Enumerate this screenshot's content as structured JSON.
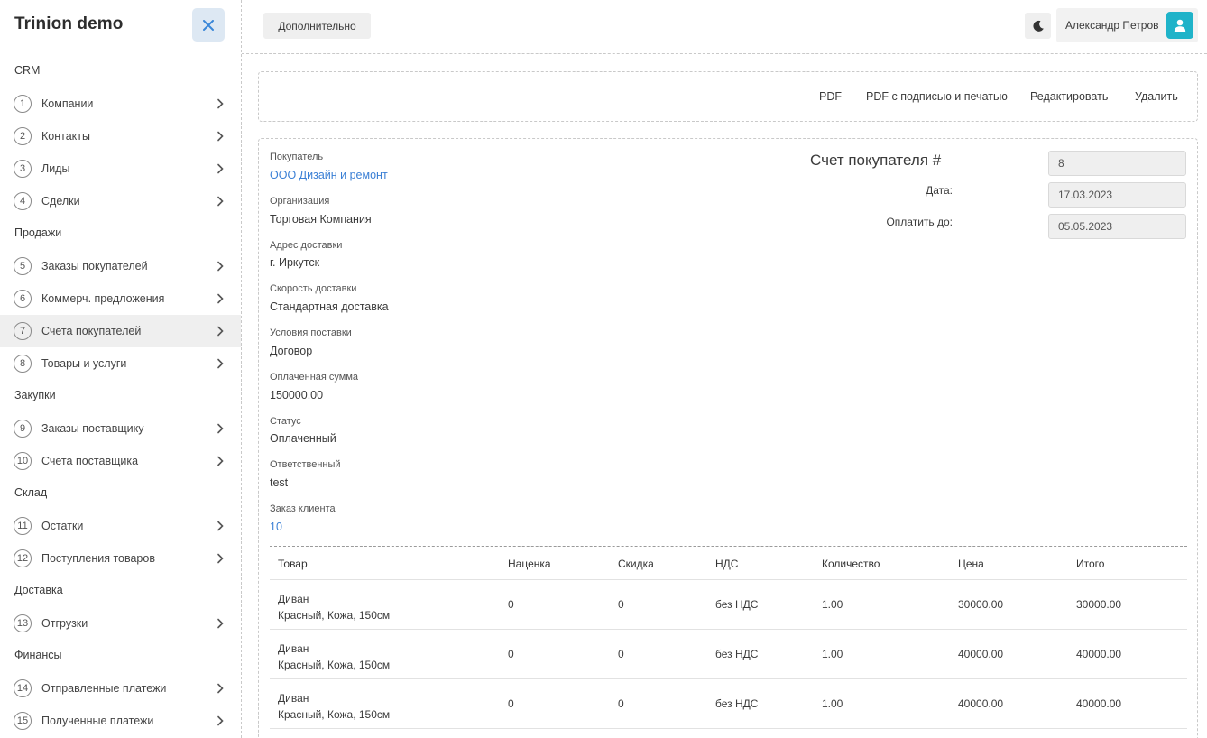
{
  "app": {
    "brand": "Trinion demo"
  },
  "sidebar": {
    "sections": [
      {
        "title": "CRM",
        "items": [
          {
            "num": "1",
            "label": "Компании"
          },
          {
            "num": "2",
            "label": "Контакты"
          },
          {
            "num": "3",
            "label": "Лиды"
          },
          {
            "num": "4",
            "label": "Сделки"
          }
        ]
      },
      {
        "title": "Продажи",
        "items": [
          {
            "num": "5",
            "label": "Заказы покупателей"
          },
          {
            "num": "6",
            "label": "Коммерч. предложения"
          },
          {
            "num": "7",
            "label": "Счета покупателей"
          },
          {
            "num": "8",
            "label": "Товары и услуги"
          }
        ]
      },
      {
        "title": "Закупки",
        "items": [
          {
            "num": "9",
            "label": "Заказы поставщику"
          },
          {
            "num": "10",
            "label": "Счета поставщика"
          }
        ]
      },
      {
        "title": "Склад",
        "items": [
          {
            "num": "11",
            "label": "Остатки"
          },
          {
            "num": "12",
            "label": "Поступления товаров"
          }
        ]
      },
      {
        "title": "Доставка",
        "items": [
          {
            "num": "13",
            "label": "Отгрузки"
          }
        ]
      },
      {
        "title": "Финансы",
        "items": [
          {
            "num": "14",
            "label": "Отправленные платежи"
          },
          {
            "num": "15",
            "label": "Полученные платежи"
          }
        ]
      }
    ]
  },
  "topbar": {
    "more_label": "Дополнительно",
    "user_name": "Александр Петров"
  },
  "actions": {
    "pdf": "PDF",
    "pdf_signed": "PDF с подписью и печатью",
    "edit": "Редактировать",
    "delete": "Удалить"
  },
  "invoice": {
    "title": "Счет покупателя #",
    "number": "8",
    "date_label": "Дата:",
    "date": "17.03.2023",
    "due_label": "Оплатить до:",
    "due": "05.05.2023"
  },
  "fields": {
    "buyer": {
      "label": "Покупатель",
      "value": "ООО Дизайн и ремонт"
    },
    "org": {
      "label": "Организация",
      "value": "Торговая Компания"
    },
    "address": {
      "label": "Адрес доставки",
      "value": "г. Иркутск"
    },
    "speed": {
      "label": "Скорость доставки",
      "value": "Стандартная доставка"
    },
    "terms": {
      "label": "Условия поставки",
      "value": "Договор"
    },
    "paid": {
      "label": "Оплаченная сумма",
      "value": "150000.00"
    },
    "status": {
      "label": "Статус",
      "value": "Оплаченный"
    },
    "responsible": {
      "label": "Ответственный",
      "value": "test"
    },
    "order": {
      "label": "Заказ клиента",
      "value": "10"
    }
  },
  "table": {
    "headers": [
      "Товар",
      "Наценка",
      "Скидка",
      "НДС",
      "Количество",
      "Цена",
      "Итого"
    ],
    "rows": [
      {
        "name": "Диван",
        "desc": "Красный, Кожа, 150см",
        "markup": "0",
        "discount": "0",
        "vat": "без НДС",
        "qty": "1.00",
        "price": "30000.00",
        "total": "30000.00"
      },
      {
        "name": "Диван",
        "desc": "Красный, Кожа, 150см",
        "markup": "0",
        "discount": "0",
        "vat": "без НДС",
        "qty": "1.00",
        "price": "40000.00",
        "total": "40000.00"
      },
      {
        "name": "Диван",
        "desc": "Красный, Кожа, 150см",
        "markup": "0",
        "discount": "0",
        "vat": "без НДС",
        "qty": "1.00",
        "price": "40000.00",
        "total": "40000.00"
      }
    ]
  },
  "colors": {
    "accent": "#1fb3c9",
    "link": "#3a7fd5",
    "close": "#3a87d8"
  },
  "icons": [
    "close-icon",
    "chevron-right-icon",
    "moon-icon",
    "user-icon"
  ]
}
